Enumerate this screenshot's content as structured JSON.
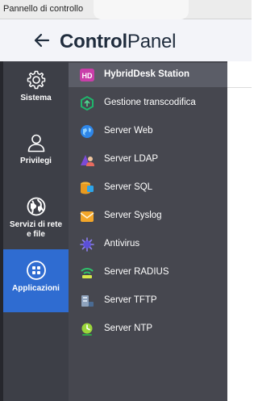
{
  "window": {
    "title": "Pannello di controllo"
  },
  "header": {
    "brand_bold": "Control",
    "brand_light": "Panel"
  },
  "nav": {
    "items": [
      {
        "label": "Sistema",
        "icon": "gear-icon",
        "active": false
      },
      {
        "label": "Privilegi",
        "icon": "user-icon",
        "active": false
      },
      {
        "label_line1": "Servizi di rete",
        "label_line2": "e file",
        "icon": "globe-icon",
        "active": false
      },
      {
        "label": "Applicazioni",
        "icon": "apps-grid-icon",
        "active": true
      }
    ]
  },
  "submenu": {
    "items": [
      {
        "label": "HybridDesk Station",
        "icon": "hybriddesk-icon",
        "active": true
      },
      {
        "label": "Gestione transcodifica",
        "icon": "transcode-icon",
        "active": false
      },
      {
        "label": "Server Web",
        "icon": "web-server-icon",
        "active": false
      },
      {
        "label": "Server LDAP",
        "icon": "ldap-icon",
        "active": false
      },
      {
        "label": "Server SQL",
        "icon": "sql-icon",
        "active": false
      },
      {
        "label": "Server Syslog",
        "icon": "syslog-icon",
        "active": false
      },
      {
        "label": "Antivirus",
        "icon": "antivirus-icon",
        "active": false
      },
      {
        "label": "Server RADIUS",
        "icon": "radius-icon",
        "active": false
      },
      {
        "label": "Server TFTP",
        "icon": "tftp-icon",
        "active": false
      },
      {
        "label": "Server NTP",
        "icon": "ntp-icon",
        "active": false
      }
    ]
  },
  "colors": {
    "nav_active": "#2f6cd1",
    "nav_bg": "#3d3f47",
    "submenu_bg": "#46474f",
    "submenu_active": "#5b5d67"
  }
}
